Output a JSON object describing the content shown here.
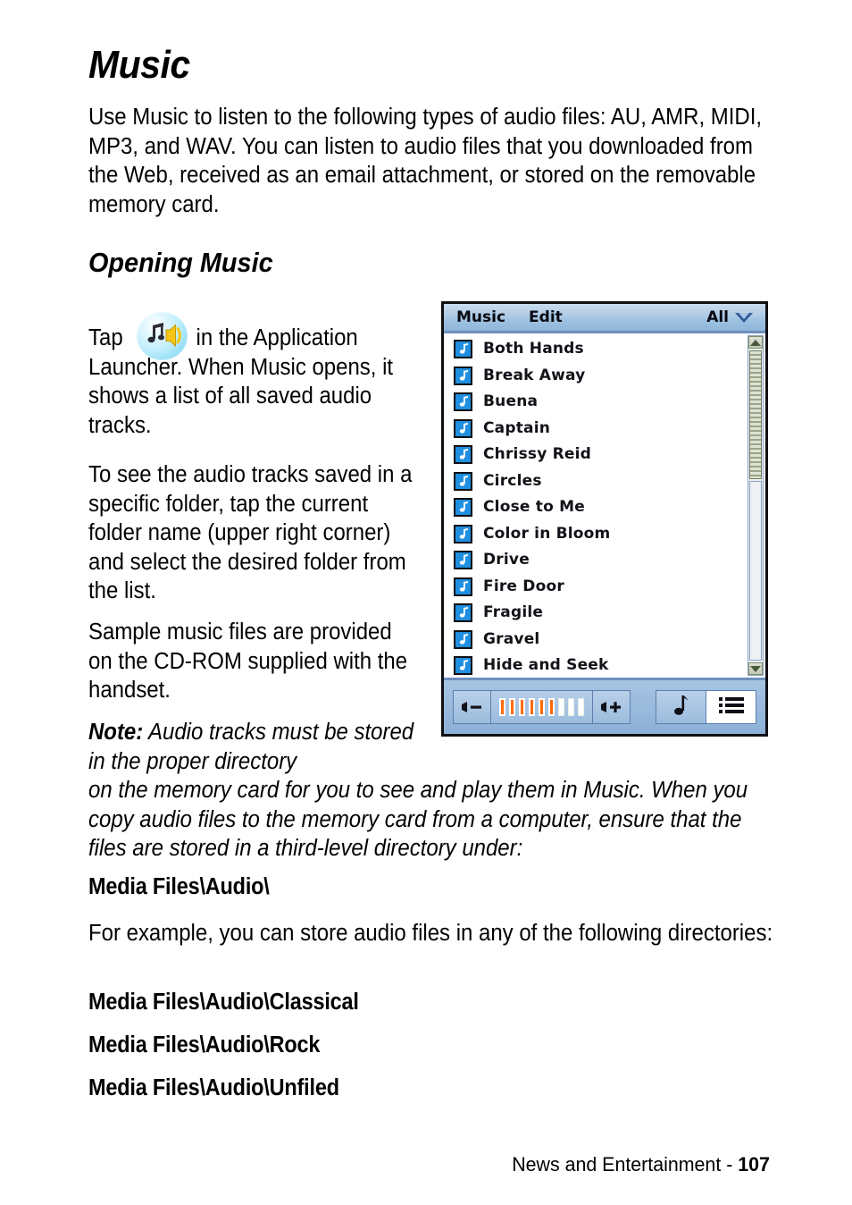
{
  "document": {
    "title": "Music",
    "intro": "Use Music to listen to the following types of audio files: AU, AMR, MIDI, MP3, and WAV. You can listen to audio files that you downloaded from the Web, received as an email attachment, or stored on the removable memory card.",
    "section_heading": "Opening Music",
    "para_tap_prefix": "Tap",
    "para_tap_suffix": "in the Application Launcher. When Music opens, it shows a list of all saved audio tracks.",
    "para_folder": "To see the audio tracks saved in a specific folder, tap the current folder name (upper right corner) and select the desired folder from the list.",
    "para_sample": "Sample music files are provided on the CD-ROM supplied with the handset.",
    "note_label": "Note:",
    "note_text_col": "Audio tracks must be stored in the proper directory",
    "note_text_wide": "on the memory card for you to see and play them in Music. When you copy audio files to the memory card from a computer, ensure that the files are stored in a third-level directory under:",
    "path_root": "Media Files\\Audio\\",
    "para_example": "For example, you can store audio files in any of the following directories:",
    "paths": [
      "Media Files\\Audio\\Classical",
      "Media Files\\Audio\\Rock",
      "Media Files\\Audio\\Unfiled"
    ],
    "footer": {
      "chapter": "News and Entertainment - ",
      "page_number": "107"
    }
  },
  "device_screenshot": {
    "titlebar": {
      "menus": [
        "Music",
        "Edit"
      ],
      "category_label": "All",
      "category_icon": "chevron-down-icon"
    },
    "tracks": [
      "Both Hands",
      "Break Away",
      "Buena",
      "Captain",
      "Chrissy Reid",
      "Circles",
      "Close to Me",
      "Color in Bloom",
      "Drive",
      "Fire Door",
      "Fragile",
      "Gravel",
      "Hide and Seek"
    ],
    "scrollbar": {
      "up_icon": "scroll-up-icon",
      "down_icon": "scroll-down-icon"
    },
    "toolbar": {
      "volume_down_icon": "volume-down-icon",
      "volume_up_icon": "volume-up-icon",
      "volume_segments_total": 9,
      "volume_segments_filled": 6,
      "now_playing_icon": "music-note-icon",
      "list_view_icon": "list-view-icon",
      "active_view": "list-view-icon"
    }
  },
  "colors": {
    "titlebar_top": "#c9dcee",
    "titlebar_bottom": "#8fb6da",
    "toolbar": "#9abadd",
    "track_icon_blue": "#1f8fe0",
    "volume_orange": "#ff6a00",
    "frame_border": "#0f0f14"
  }
}
